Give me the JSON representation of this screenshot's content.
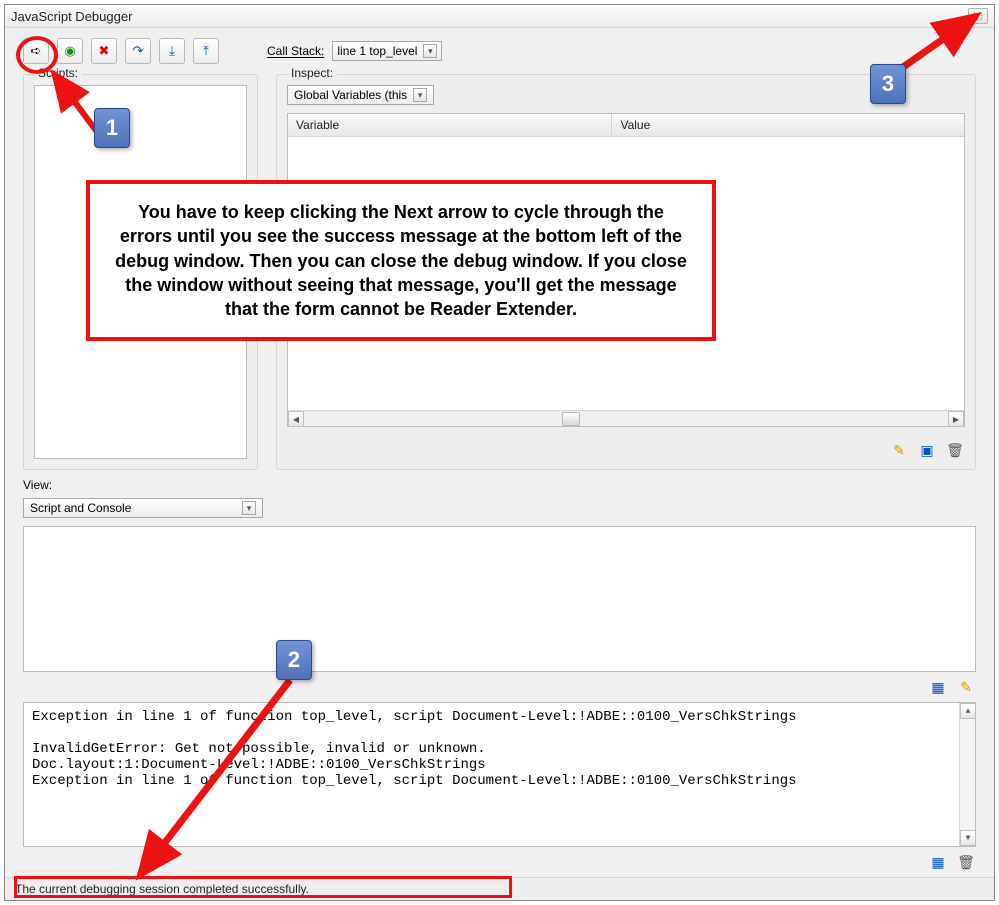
{
  "window": {
    "title": "JavaScript Debugger",
    "close_glyph": "⬚"
  },
  "toolbar": {
    "step_next": "➪",
    "breakpoint": "◉",
    "stop": "✖",
    "step_over": "↷",
    "step_into": "⤓",
    "step_out": "⤒",
    "callstack_label": "Call Stack:",
    "callstack_value": "line 1 top_level"
  },
  "scripts": {
    "label": "Scripts:"
  },
  "inspect": {
    "label": "Inspect:",
    "scope_value": "Global Variables (this",
    "columns": {
      "variable": "Variable",
      "value": "Value"
    },
    "icons": {
      "edit": "✎",
      "new": "▣",
      "delete": "🗑"
    }
  },
  "view": {
    "label": "View:",
    "select_value": "Script and Console",
    "icons": {
      "stack": "▦",
      "edit": "✎"
    }
  },
  "console": {
    "text": "Exception in line 1 of function top_level, script Document-Level:!ADBE::0100_VersChkStrings\n\nInvalidGetError: Get not possible, invalid or unknown.\nDoc.layout:1:Document-Level:!ADBE::0100_VersChkStrings\nException in line 1 of function top_level, script Document-Level:!ADBE::0100_VersChkStrings",
    "icons": {
      "stack": "▦",
      "delete": "🗑"
    }
  },
  "status": {
    "text": "The current debugging session completed successfully."
  },
  "annotations": {
    "callout_text": "You have to keep clicking the Next arrow to cycle through the errors until you see the success message at the bottom left of the debug window.  Then you can close the debug window.  If you close the window without seeing that message, you'll get the message that the form cannot be Reader Extender.",
    "badge1": "1",
    "badge2": "2",
    "badge3": "3"
  }
}
